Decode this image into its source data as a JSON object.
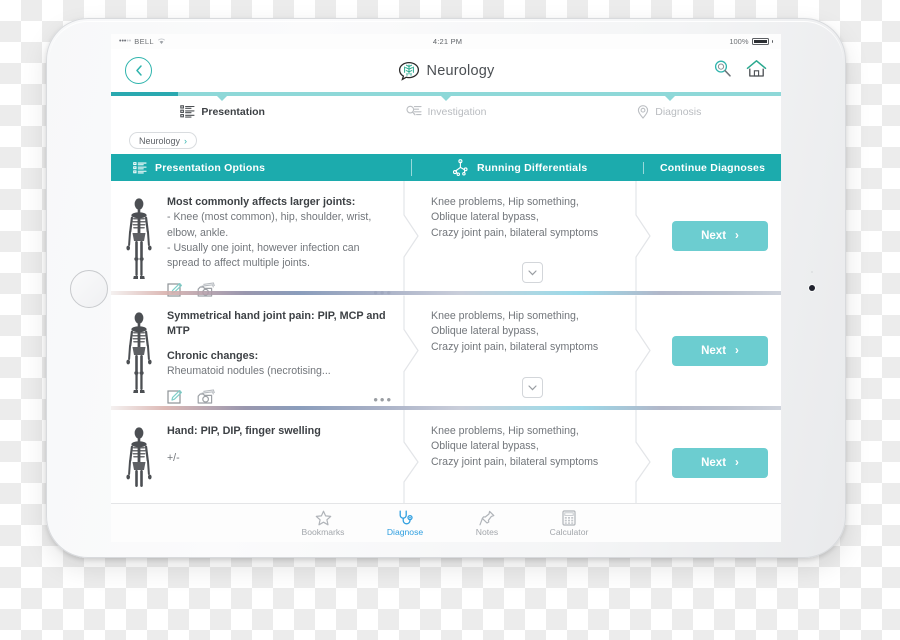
{
  "statusbar": {
    "signal_dots": "•••",
    "signal_dots_off": "••",
    "carrier": "BELL",
    "time": "4:21 PM",
    "battery_pct": "100%"
  },
  "header": {
    "back_label": "‹",
    "title": "Neurology",
    "brain_icon": "brain-icon",
    "search_icon": "search-icon",
    "home_icon": "home-icon"
  },
  "progress": {
    "percent": 10
  },
  "section_tabs": [
    {
      "label": "Presentation",
      "icon": "list-checklist-icon",
      "active": true
    },
    {
      "label": "Investigation",
      "icon": "magnifier-list-icon",
      "active": false
    },
    {
      "label": "Diagnosis",
      "icon": "location-pin-icon",
      "active": false
    }
  ],
  "breadcrumb": {
    "label": "Neurology",
    "arrow": "›"
  },
  "columns": [
    {
      "label": "Presentation Options",
      "icon": "list-checklist-icon"
    },
    {
      "label": "Running Differentials",
      "icon": "molecule-node-icon"
    },
    {
      "label": "Continue Diagnoses",
      "icon": ""
    }
  ],
  "cards": [
    {
      "skeleton_icon": "skeleton-icon",
      "title": "Most commonly affects larger joints:",
      "lines": [
        "- Knee (most common), hip, shoulder, wrist, elbow, ankle.",
        "- Usually one joint, however infection can spread to affect multiple joints."
      ],
      "subtitle": "",
      "sublines": [],
      "actions": {
        "edit_icon": "edit-note-icon",
        "photo_icon": "photo-camera-icon",
        "more": "•••"
      },
      "differentials": [
        "Knee problems, Hip something,",
        "Oblique lateral bypass,",
        "Crazy joint pain, bilateral symptoms"
      ],
      "expand_icon": "chevron-down-icon",
      "next_label": "Next",
      "next_arrow": "›"
    },
    {
      "skeleton_icon": "skeleton-icon",
      "title": "Symmetrical hand joint pain: PIP, MCP and MTP",
      "lines": [],
      "subtitle": "Chronic changes:",
      "sublines": [
        "Rheumatoid nodules (necrotising..."
      ],
      "actions": {
        "edit_icon": "edit-note-icon",
        "photo_icon": "photo-camera-icon",
        "more": "•••"
      },
      "differentials": [
        "Knee problems, Hip something,",
        "Oblique lateral bypass,",
        "Crazy joint pain, bilateral symptoms"
      ],
      "expand_icon": "chevron-down-icon",
      "next_label": "Next",
      "next_arrow": "›"
    },
    {
      "skeleton_icon": "skeleton-icon",
      "title": "Hand: PIP, DIP, finger swelling",
      "lines": [
        "+/-"
      ],
      "subtitle": "",
      "sublines": [],
      "actions": {
        "edit_icon": "edit-note-icon",
        "photo_icon": "photo-camera-icon",
        "more": "•••"
      },
      "differentials": [
        "Knee problems, Hip something,",
        "Oblique lateral bypass,",
        "Crazy joint pain, bilateral symptoms"
      ],
      "expand_icon": "chevron-down-icon",
      "next_label": "Next",
      "next_arrow": "›"
    }
  ],
  "tabbar": [
    {
      "label": "Bookmarks",
      "icon": "star-icon",
      "active": false
    },
    {
      "label": "Diagnose",
      "icon": "stethoscope-icon",
      "active": true
    },
    {
      "label": "Notes",
      "icon": "pin-icon",
      "active": false
    },
    {
      "label": "Calculator",
      "icon": "calculator-icon",
      "active": false
    }
  ],
  "colors": {
    "teal_header": "#1cabad",
    "teal_accent": "#2fb4ad",
    "teal_button": "#6ccdd0",
    "progress_light": "#8ed8d8",
    "progress_dark": "#2aa9b0",
    "active_tab_blue": "#2f9fe0"
  }
}
